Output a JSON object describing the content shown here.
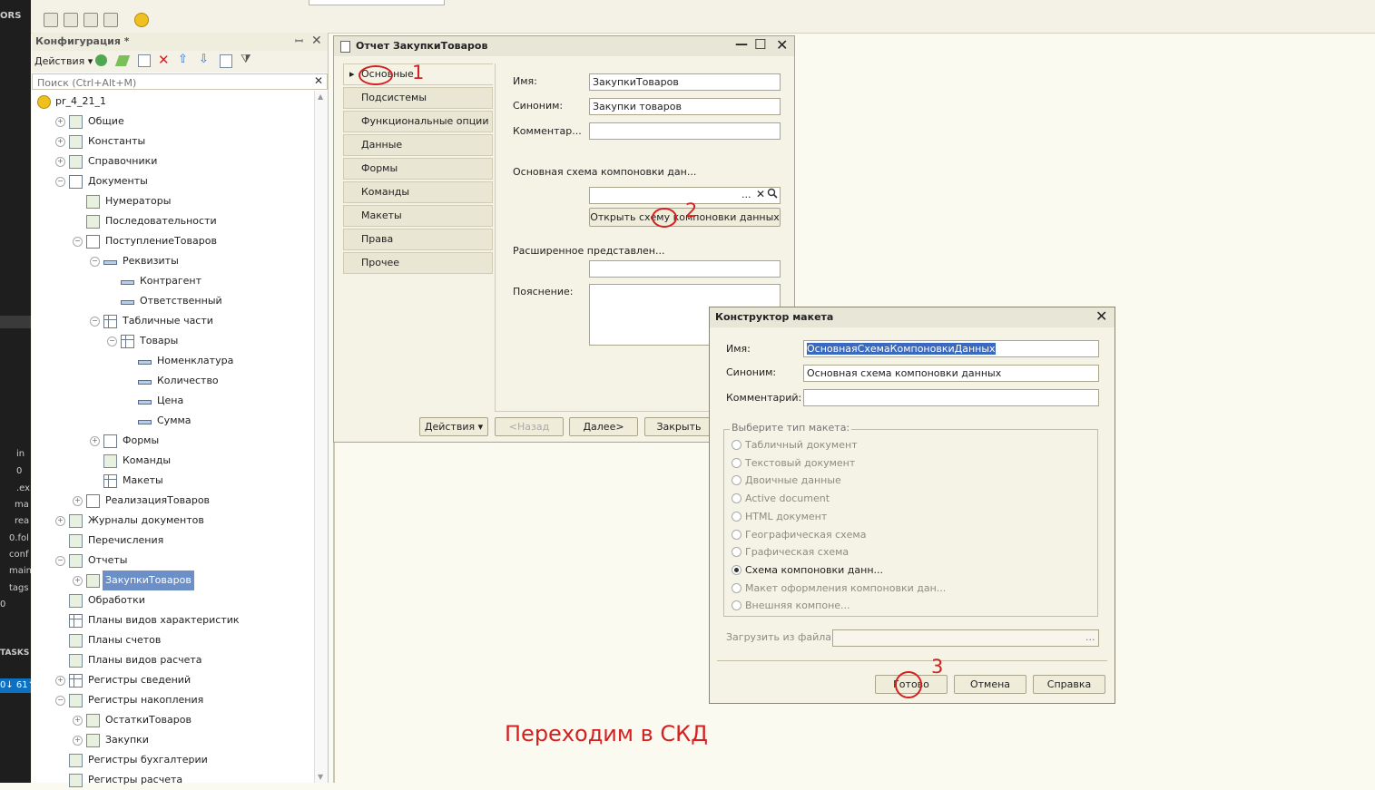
{
  "sidebar_strip": {
    "top_text": "ORS",
    "mid_items": [
      "in",
      "0",
      ".ex",
      "ma",
      "rea",
      "0.fol",
      "conf",
      "main",
      "tags",
      "0"
    ],
    "tasks": "TASKS",
    "status": "0↓ 61↑"
  },
  "config_panel": {
    "title": "Конфигурация *",
    "pin": "ꟷ",
    "close": "✕",
    "actions_label": "Действия",
    "search_placeholder": "Поиск (Ctrl+Alt+M)",
    "search_clear": "✕",
    "tree": [
      {
        "label": "pr_4_21_1",
        "level": 0,
        "exp": "",
        "icon": "root"
      },
      {
        "label": "Общие",
        "level": 1,
        "exp": "+",
        "icon": "common"
      },
      {
        "label": "Константы",
        "level": 1,
        "exp": "+",
        "icon": "const"
      },
      {
        "label": "Справочники",
        "level": 1,
        "exp": "+",
        "icon": "catalog"
      },
      {
        "label": "Документы",
        "level": 1,
        "exp": "−",
        "icon": "doc"
      },
      {
        "label": "Нумераторы",
        "level": 2,
        "exp": "",
        "icon": "numer"
      },
      {
        "label": "Последовательности",
        "level": 2,
        "exp": "",
        "icon": "seq"
      },
      {
        "label": "ПоступлениеТоваров",
        "level": 2,
        "exp": "−",
        "icon": "doc"
      },
      {
        "label": "Реквизиты",
        "level": 3,
        "exp": "−",
        "icon": "attr"
      },
      {
        "label": "Контрагент",
        "level": 4,
        "exp": "",
        "icon": "attr"
      },
      {
        "label": "Ответственный",
        "level": 4,
        "exp": "",
        "icon": "attr"
      },
      {
        "label": "Табличные части",
        "level": 3,
        "exp": "−",
        "icon": "tbl"
      },
      {
        "label": "Товары",
        "level": 4,
        "exp": "−",
        "icon": "tbl"
      },
      {
        "label": "Номенклатура",
        "level": 5,
        "exp": "",
        "icon": "attr"
      },
      {
        "label": "Количество",
        "level": 5,
        "exp": "",
        "icon": "attr"
      },
      {
        "label": "Цена",
        "level": 5,
        "exp": "",
        "icon": "attr"
      },
      {
        "label": "Сумма",
        "level": 5,
        "exp": "",
        "icon": "attr"
      },
      {
        "label": "Формы",
        "level": 3,
        "exp": "+",
        "icon": "doc"
      },
      {
        "label": "Команды",
        "level": 3,
        "exp": "",
        "icon": "cmd"
      },
      {
        "label": "Макеты",
        "level": 3,
        "exp": "",
        "icon": "tbl"
      },
      {
        "label": "РеализацияТоваров",
        "level": 2,
        "exp": "+",
        "icon": "doc"
      },
      {
        "label": "Журналы документов",
        "level": 1,
        "exp": "+",
        "icon": "journal"
      },
      {
        "label": "Перечисления",
        "level": 1,
        "exp": "",
        "icon": "enum"
      },
      {
        "label": "Отчеты",
        "level": 1,
        "exp": "−",
        "icon": "report"
      },
      {
        "label": "ЗакупкиТоваров",
        "level": 2,
        "exp": "+",
        "icon": "report",
        "selected": true
      },
      {
        "label": "Обработки",
        "level": 1,
        "exp": "",
        "icon": "proc"
      },
      {
        "label": "Планы видов характеристик",
        "level": 1,
        "exp": "",
        "icon": "tbl"
      },
      {
        "label": "Планы счетов",
        "level": 1,
        "exp": "",
        "icon": "accounts"
      },
      {
        "label": "Планы видов расчета",
        "level": 1,
        "exp": "",
        "icon": "calc"
      },
      {
        "label": "Регистры сведений",
        "level": 1,
        "exp": "+",
        "icon": "tbl"
      },
      {
        "label": "Регистры накопления",
        "level": 1,
        "exp": "−",
        "icon": "accum"
      },
      {
        "label": "ОстаткиТоваров",
        "level": 2,
        "exp": "+",
        "icon": "accum"
      },
      {
        "label": "Закупки",
        "level": 2,
        "exp": "+",
        "icon": "accum"
      },
      {
        "label": "Регистры бухгалтерии",
        "level": 1,
        "exp": "",
        "icon": "accounts"
      },
      {
        "label": "Регистры расчета",
        "level": 1,
        "exp": "",
        "icon": "calc"
      }
    ]
  },
  "report_window": {
    "title": "Отчет ЗакупкиТоваров",
    "tabs": [
      "Основные",
      "Подсистемы",
      "Функциональные опции",
      "Данные",
      "Формы",
      "Команды",
      "Макеты",
      "Права",
      "Прочее"
    ],
    "name_label": "Имя:",
    "name_value": "ЗакупкиТоваров",
    "synonym_label": "Синоним:",
    "synonym_value": "Закупки товаров",
    "comment_label": "Комментар...",
    "comment_value": "",
    "schema_label": "Основная схема компоновки дан...",
    "schema_value": "",
    "schema_btn_more": "...",
    "schema_btn_clear": "✕",
    "schema_btn_search": "🔍",
    "open_schema_button": "Открыть схему компоновки данных",
    "extended_label": "Расширенное представлен...",
    "explanation_label": "Пояснение:",
    "actions_button": "Действия",
    "back_button": "<Назад",
    "next_button": "Далее>",
    "close_button": "Закрыть",
    "min_icon": "—",
    "max_icon": "☐",
    "close_icon": "✕"
  },
  "constructor_dialog": {
    "title": "Конструктор макета",
    "close_icon": "✕",
    "name_label": "Имя:",
    "name_value": "ОсновнаяСхемаКомпоновкиДанных",
    "synonym_label": "Синоним:",
    "synonym_value": "Основная схема компоновки данных",
    "comment_label": "Комментарий:",
    "comment_value": "",
    "group_label": "Выберите тип макета:",
    "types": [
      {
        "label": "Табличный документ",
        "selected": false
      },
      {
        "label": "Текстовый документ",
        "selected": false
      },
      {
        "label": "Двоичные данные",
        "selected": false
      },
      {
        "label": "Active document",
        "selected": false
      },
      {
        "label": "HTML документ",
        "selected": false
      },
      {
        "label": "Географическая схема",
        "selected": false
      },
      {
        "label": "Графическая схема",
        "selected": false
      },
      {
        "label": "Схема компоновки данн...",
        "selected": true
      },
      {
        "label": "Макет оформления компоновки дан...",
        "selected": false
      },
      {
        "label": "Внешняя компоне...",
        "selected": false
      }
    ],
    "load_label": "Загрузить из файла:",
    "load_btn": "...",
    "done_button": "Готово",
    "cancel_button": "Отмена",
    "help_button": "Справка"
  },
  "annotations": {
    "marker1": "1",
    "marker2": "2",
    "marker3": "3",
    "caption": "Переходим в СКД",
    "color": "#d42020"
  }
}
